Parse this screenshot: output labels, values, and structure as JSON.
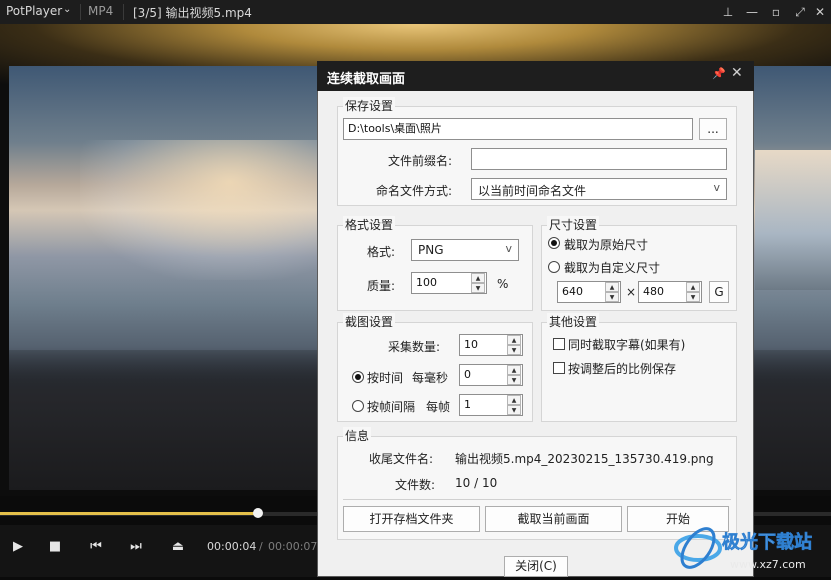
{
  "player": {
    "brand": "PotPlayer",
    "format": "MP4",
    "title": "[3/5] 输出视频5.mp4",
    "time_current": "00:00:04",
    "time_separator": "/",
    "time_total": "00:00:07",
    "progress_fraction": 0.31
  },
  "dialog": {
    "title": "连续截取画面",
    "save": {
      "group_label": "保存设置",
      "path_value": "D:\\tools\\桌面\\照片",
      "browse_label": "...",
      "prefix_label": "文件前缀名:",
      "prefix_value": "",
      "naming_label": "命名文件方式:",
      "naming_value": "以当前时间命名文件"
    },
    "format": {
      "group_label": "格式设置",
      "format_label": "格式:",
      "format_value": "PNG",
      "quality_label": "质量:",
      "quality_value": "100",
      "quality_unit": "%"
    },
    "size": {
      "group_label": "尺寸设置",
      "original_label": "截取为原始尺寸",
      "custom_label": "截取为自定义尺寸",
      "width_value": "640",
      "times": "×",
      "height_value": "480",
      "g_label": "G"
    },
    "capture": {
      "group_label": "截图设置",
      "count_label": "采集数量:",
      "count_value": "10",
      "by_time_label": "按时间",
      "per_ms_label": "每毫秒",
      "ms_value": "0",
      "by_frame_label": "按帧间隔",
      "per_frame_label": "每帧",
      "frame_value": "1"
    },
    "other": {
      "group_label": "其他设置",
      "subtitle_label": "同时截取字幕(如果有)",
      "ratio_label": "按调整后的比例保存"
    },
    "info": {
      "group_label": "信息",
      "last_file_label": "收尾文件名:",
      "last_file_value": "输出视频5.mp4_20230215_135730.419.png",
      "file_count_label": "文件数:",
      "file_count_value": "10 / 10"
    },
    "buttons": {
      "open_folder": "打开存档文件夹",
      "capture_current": "截取当前画面",
      "start": "开始",
      "close": "关闭(C)"
    }
  },
  "watermark": {
    "text": "极光下载站",
    "url": "www.xz7.com"
  }
}
